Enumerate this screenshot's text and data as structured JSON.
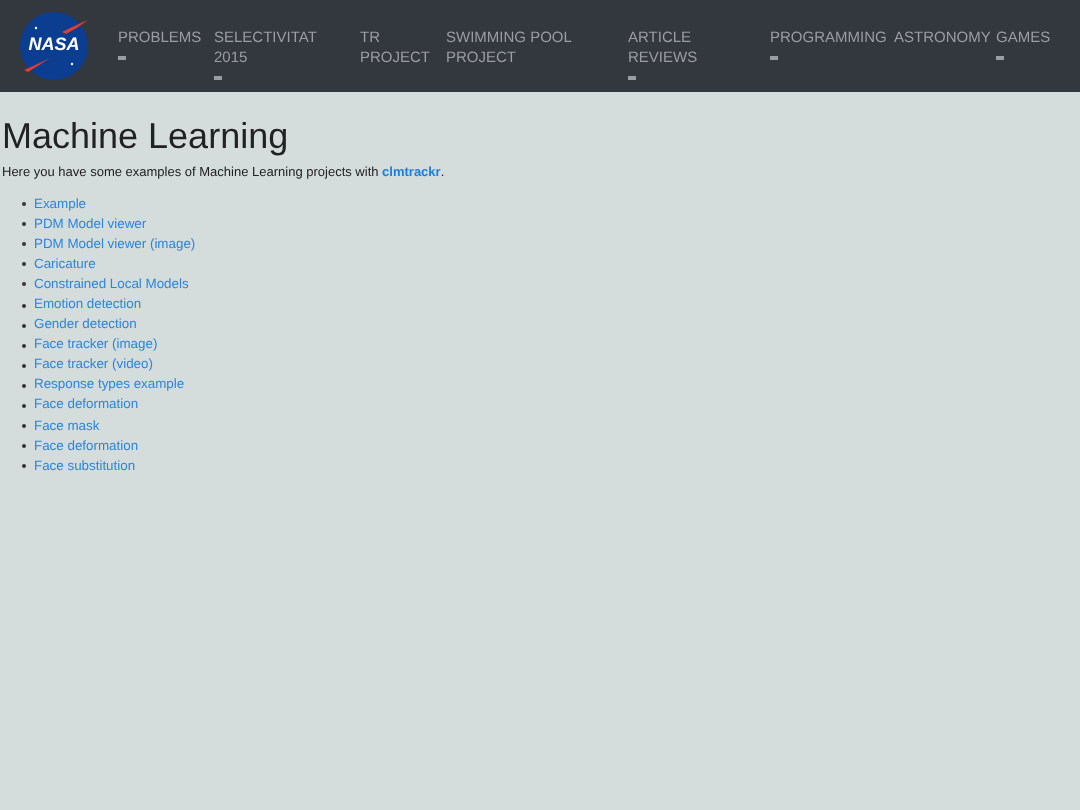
{
  "logo": {
    "text": "NASA"
  },
  "nav": [
    {
      "label": "PROBLEMS",
      "dropdown": true
    },
    {
      "label": "SELECTIVITAT 2015",
      "dropdown": true
    },
    {
      "label": "TR PROJECT",
      "dropdown": false
    },
    {
      "label": "SWIMMING POOL PROJECT",
      "dropdown": false
    },
    {
      "label": "ARTICLE REVIEWS",
      "dropdown": true
    },
    {
      "label": "PROGRAMMING",
      "dropdown": true
    },
    {
      "label": "ASTRONOMY",
      "dropdown": false
    },
    {
      "label": "GAMES",
      "dropdown": true
    }
  ],
  "heading": "Machine Learning",
  "intro": "Here you have some examples of Machine Learning projects with",
  "intro_link": "clmtrackr",
  "intro_end": ".",
  "links": [
    "Example",
    "PDM Model viewer",
    "PDM Model viewer (image)",
    "Caricature",
    "Constrained Local Models",
    "Emotion detection",
    "Gender detection",
    "Face tracker (image)",
    "Face tracker (video)",
    "Response types example",
    "Face deformation",
    "Face mask",
    "Face deformation",
    "Face substitution"
  ]
}
